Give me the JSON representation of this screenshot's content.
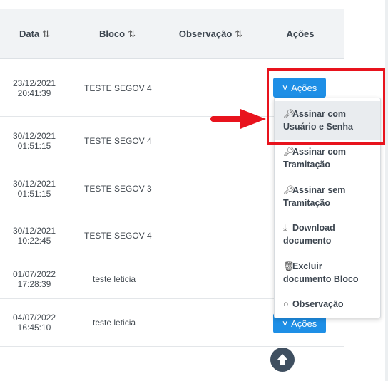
{
  "table": {
    "headers": {
      "data": "Data",
      "bloco": "Bloco",
      "observacao": "Observação",
      "acoes": "Ações",
      "sort_icon": "⇅"
    },
    "rows": [
      {
        "date": "23/12/2021",
        "time": "20:41:39",
        "bloco": "TESTE SEGOV 4"
      },
      {
        "date": "30/12/2021",
        "time": "01:51:15",
        "bloco": "TESTE SEGOV 4"
      },
      {
        "date": "30/12/2021",
        "time": "01:51:15",
        "bloco": "TESTE SEGOV 3"
      },
      {
        "date": "30/12/2021",
        "time": "10:22:45",
        "bloco": "TESTE SEGOV 4"
      },
      {
        "date": "01/07/2022",
        "time": "17:28:39",
        "bloco": "teste leticia"
      },
      {
        "date": "04/07/2022",
        "time": "16:45:10",
        "bloco": "teste leticia"
      }
    ],
    "acoes_button_label": "Ações"
  },
  "dropdown": {
    "items": [
      {
        "icon": "key-icon",
        "line1": "Assinar com",
        "line2": "Usuário e Senha"
      },
      {
        "icon": "key-icon",
        "line1": "Assinar com",
        "line2": "Tramitação"
      },
      {
        "icon": "key-icon",
        "line1": "Assinar sem",
        "line2": "Tramitação"
      },
      {
        "icon": "download-icon",
        "line1": "Download",
        "line2": "documento"
      },
      {
        "icon": "trash-icon",
        "line1": "Excluir",
        "line2": "documento Bloco"
      },
      {
        "icon": "comment-icon",
        "line1": "Observação",
        "line2": ""
      }
    ]
  },
  "colors": {
    "primary_button": "#1e8fe6",
    "annotation_red": "#e8131d",
    "header_bg": "#f1f3f5",
    "scroll_top_bg": "#3f4f60"
  }
}
